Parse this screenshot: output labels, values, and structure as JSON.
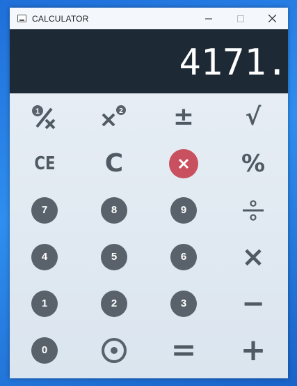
{
  "window": {
    "title": "CALCULATOR"
  },
  "display": {
    "value": "4171."
  },
  "keys": {
    "ce": "CE",
    "c": "C",
    "percent": "%",
    "seven": "7",
    "eight": "8",
    "nine": "9",
    "four": "4",
    "five": "5",
    "six": "6",
    "one": "1",
    "two": "2",
    "three": "3",
    "zero": "0",
    "plus_minus": "±",
    "sqrt": "√",
    "multiply": "×",
    "equals": "=",
    "plus": "+",
    "minus": "−",
    "reciprocal_num": "1",
    "square_exp": "2"
  },
  "colors": {
    "display_bg": "#1d2a36",
    "key_circle": "#59626b",
    "backspace": "#c9505f",
    "symbol": "#4f5a63"
  },
  "icons": [
    "app-icon",
    "minimize-icon",
    "maximize-icon",
    "close-icon",
    "reciprocal-icon",
    "square-icon",
    "backspace-icon",
    "divide-icon",
    "decimal-point-icon"
  ]
}
